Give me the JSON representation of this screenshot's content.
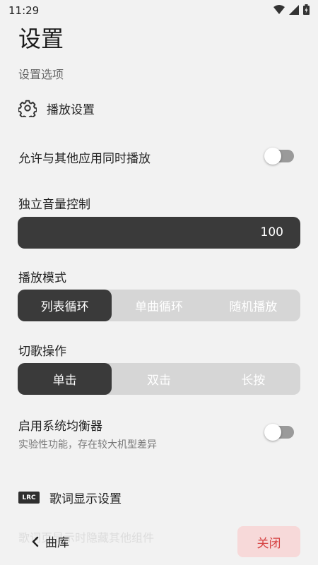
{
  "status_bar": {
    "time": "11:29"
  },
  "page_title": "设置",
  "subheader": "设置选项",
  "playback_section": {
    "icon": "gear-icon",
    "label": "播放设置"
  },
  "allow_simultaneous": {
    "label": "允许与其他应用同时播放",
    "enabled": false
  },
  "independent_volume": {
    "label": "独立音量控制",
    "value": "100"
  },
  "play_mode": {
    "label": "播放模式",
    "options": [
      "列表循环",
      "单曲循环",
      "随机播放"
    ],
    "selected": "列表循环"
  },
  "switch_operation": {
    "label": "切歌操作",
    "options": [
      "单击",
      "双击",
      "长按"
    ],
    "selected": "单击"
  },
  "system_equalizer": {
    "label": "启用系统均衡器",
    "description": "实验性功能，存在较大机型差异",
    "enabled": false
  },
  "lyrics_section": {
    "badge": "LRC",
    "label": "歌词显示设置"
  },
  "lyrics_ghost_rows": [
    "歌词页显示时隐藏其他组件"
  ],
  "bottom_nav": {
    "back_label": "曲库",
    "close_label": "关闭"
  },
  "colors": {
    "dark": "#3a3a3a",
    "toggle_off": "#9a9a9a",
    "close_bg": "#f7d9d9",
    "close_text": "#d64545"
  }
}
